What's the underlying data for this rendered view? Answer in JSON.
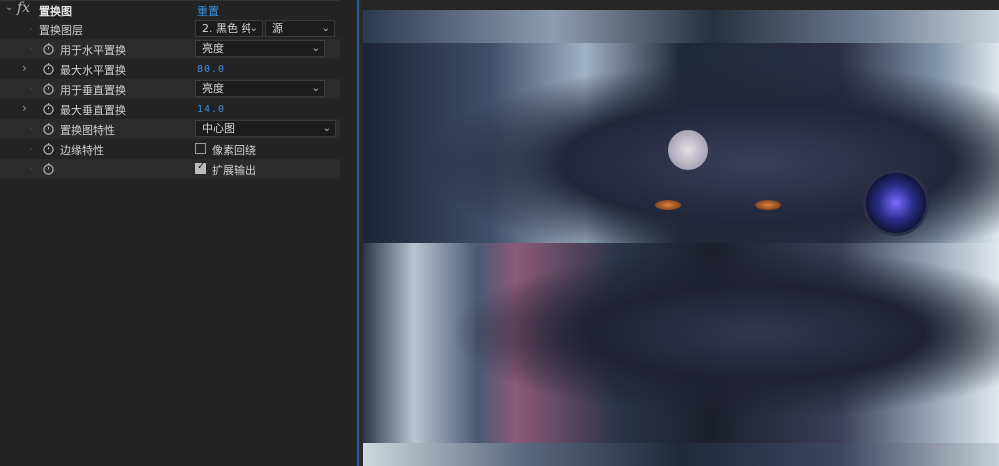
{
  "effect": {
    "title": "置换图",
    "reset_label": "重置"
  },
  "properties": [
    {
      "label": "置换图层",
      "value_a": "2. 黑色 纯",
      "value_b": "源"
    },
    {
      "label": "用于水平置换",
      "value": "亮度"
    },
    {
      "label": "最大水平置换",
      "value": "80.0"
    },
    {
      "label": "用于垂直置换",
      "value": "亮度"
    },
    {
      "label": "最大垂直置换",
      "value": "14.0"
    },
    {
      "label": "置换图特性",
      "value": "中心图"
    },
    {
      "label": "边缘特性",
      "checkbox_label": "像素回绕",
      "checked": false
    },
    {
      "label": "",
      "checkbox_label": "扩展输出",
      "checked": true
    }
  ],
  "icons": {
    "fx": "fx-icon",
    "stopwatch": "stopwatch-icon",
    "chevron": "chevron-down-icon",
    "twirl": "chevron-right-icon"
  },
  "colors": {
    "accent_blue": "#3d8fe0",
    "panel_bg": "#232323",
    "viewer_edge": "#2b5f99"
  }
}
